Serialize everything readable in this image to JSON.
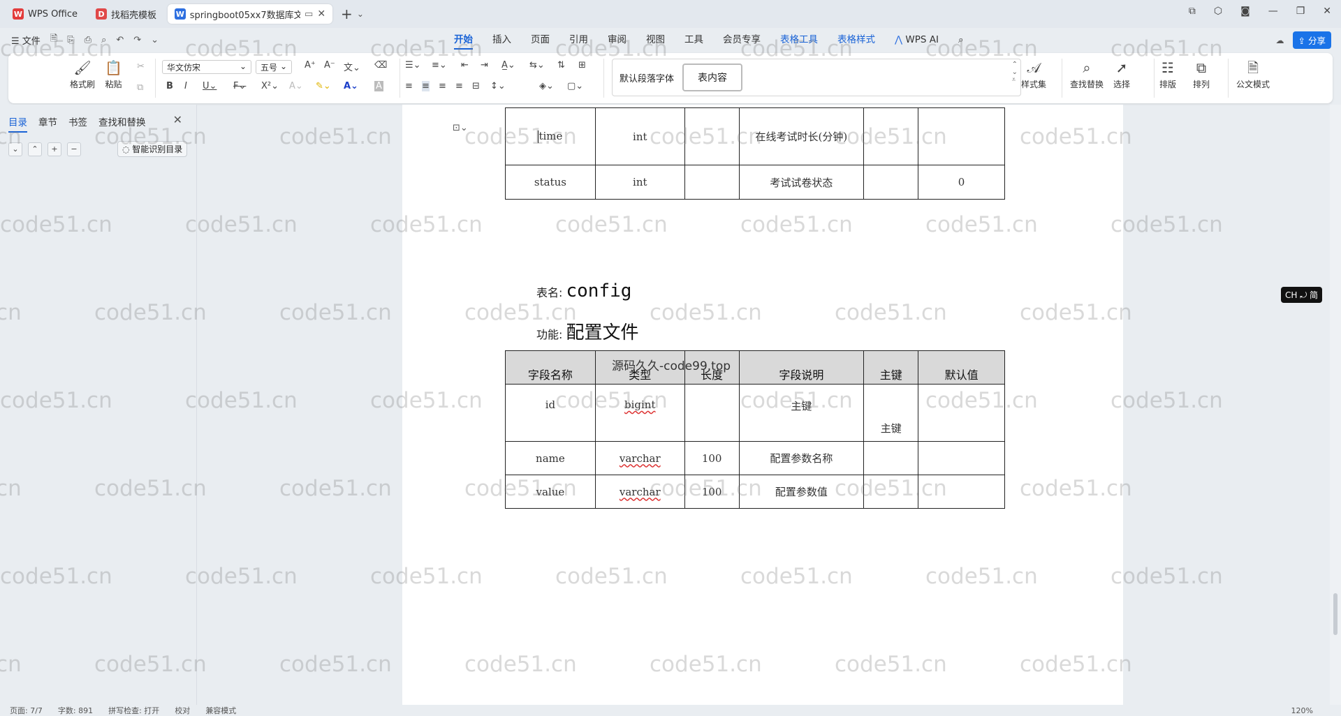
{
  "tabs": [
    {
      "label": "WPS Office",
      "icon": "W"
    },
    {
      "label": "找稻壳模板",
      "icon": "D"
    },
    {
      "label": "springboot05xx7数据库文",
      "icon": "W"
    }
  ],
  "menu": {
    "file": "文件",
    "tabs": [
      "开始",
      "插入",
      "页面",
      "引用",
      "审阅",
      "视图",
      "工具",
      "会员专享",
      "表格工具",
      "表格样式"
    ],
    "wps_ai": "WPS AI",
    "share": "分享"
  },
  "ribbon": {
    "format_painter": "格式刷",
    "paste": "粘贴",
    "font": "华文仿宋",
    "size": "五号",
    "style_default": "默认段落字体",
    "style_selected": "表内容",
    "style_set": "样式集",
    "find_replace": "查找替换",
    "select": "选择",
    "layout": "排版",
    "arrange": "排列",
    "doc_mode": "公文模式"
  },
  "leftpanel": {
    "tabs": [
      "目录",
      "章节",
      "书签",
      "查找和替换"
    ],
    "ai_toc": "智能识别目录"
  },
  "doc": {
    "table1": [
      [
        "time",
        "int",
        "",
        "在线考试时长(分钟)",
        "",
        ""
      ],
      [
        "status",
        "int",
        "",
        "考试试卷状态",
        "",
        "0"
      ]
    ],
    "tablename_label": "表名:",
    "tablename": "config",
    "function_label": "功能:",
    "function": "配置文件",
    "overlay": "源码久久-code99.top",
    "table2_header": [
      "字段名称",
      "类型",
      "长度",
      "字段说明",
      "主键",
      "默认值"
    ],
    "table2": [
      [
        "id",
        "bigint",
        "",
        "主键",
        "主键",
        ""
      ],
      [
        "name",
        "varchar",
        "100",
        "配置参数名称",
        "",
        ""
      ],
      [
        "value",
        "varchar",
        "100",
        "配置参数值",
        "",
        ""
      ]
    ]
  },
  "watermark": "code51.cn",
  "ime": "CH ⤾ 简",
  "status": {
    "page": "页面: 7/7",
    "words": "字数: 891",
    "spell": "拼写检查: 打开",
    "proof": "校对",
    "compat": "兼容模式",
    "zoom": "120%"
  }
}
